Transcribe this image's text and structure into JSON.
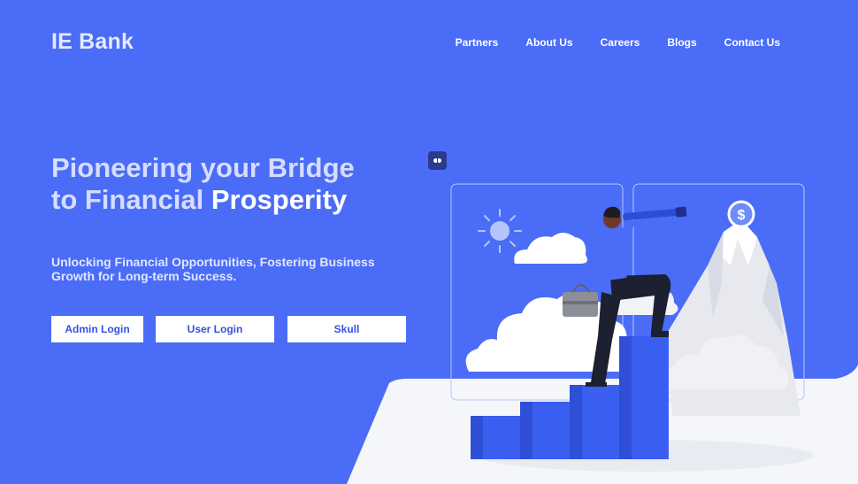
{
  "header": {
    "logo": "IE Bank",
    "nav": [
      "Partners",
      "About Us",
      "Careers",
      "Blogs",
      "Contact Us"
    ]
  },
  "hero": {
    "title_line1": "Pioneering your Bridge",
    "title_line2_prefix": "to Financial ",
    "title_line2_accent": "Prosperity",
    "subtitle": "Unlocking Financial Opportunities, Fostering Business Growth for Long-term Success."
  },
  "buttons": {
    "admin_login": "Admin Login",
    "user_login": "User Login",
    "skull": "Skull"
  },
  "illustration": {
    "coin_symbol": "$"
  },
  "colors": {
    "background": "#4a6cf7",
    "button_text": "#3550e0",
    "stairs": "#3a5ef0"
  }
}
